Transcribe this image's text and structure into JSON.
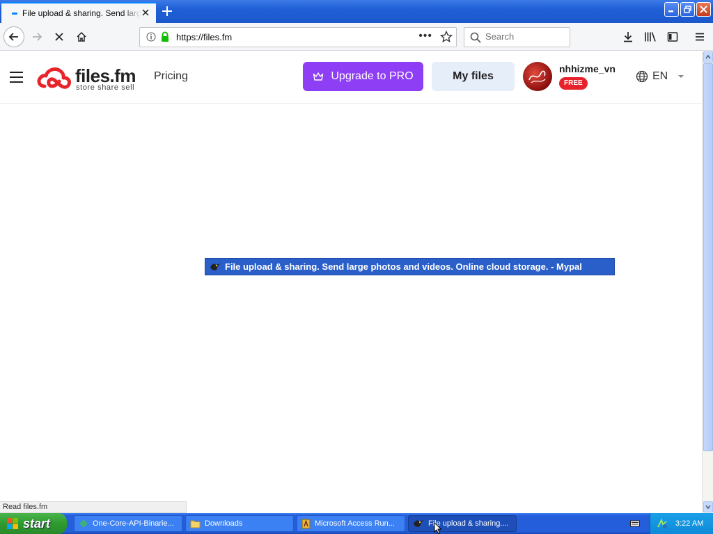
{
  "browser": {
    "tab_title": "File upload & sharing. Send large photos and videos. Online cloud storage.",
    "url": "https://files.fm",
    "search_placeholder": "Search",
    "status_text": "Read files.fm"
  },
  "site": {
    "brand_name": "files.fm",
    "brand_tagline": "store share sell",
    "nav_pricing": "Pricing",
    "upgrade_label": "Upgrade to PRO",
    "myfiles_label": "My files",
    "username": "nhhizme_vn",
    "plan_badge": "FREE",
    "language": "EN",
    "accent_color": "#8e3ef5"
  },
  "tooltip": {
    "text": "File upload & sharing. Send large photos and videos. Online cloud storage. - Mypal"
  },
  "taskbar": {
    "start_label": "start",
    "items": [
      {
        "label": "One-Core-API-Binarie...",
        "icon": "git-icon"
      },
      {
        "label": "Downloads",
        "icon": "folder-icon"
      },
      {
        "label": "Microsoft Access Run...",
        "icon": "access-icon"
      },
      {
        "label": "File upload & sharing....",
        "icon": "mypal-icon"
      }
    ],
    "clock": "3:22 AM"
  }
}
